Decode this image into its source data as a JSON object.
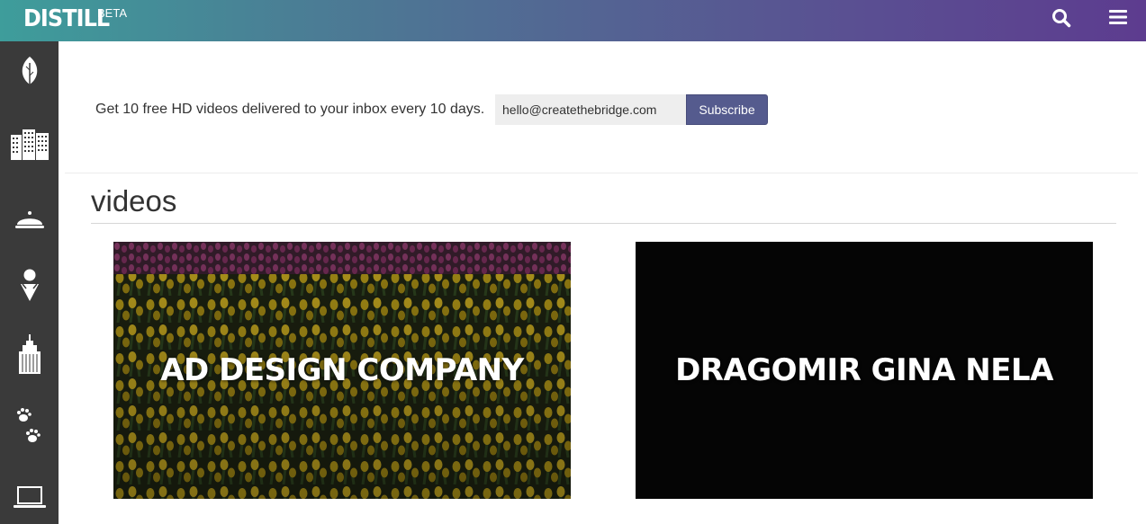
{
  "header": {
    "brand": "DISTILL",
    "beta": "BETA"
  },
  "sidebar": {
    "items": [
      {
        "icon": "leaf-icon"
      },
      {
        "icon": "buildings-icon"
      },
      {
        "icon": "food-cloche-icon"
      },
      {
        "icon": "person-pin-icon"
      },
      {
        "icon": "skyscraper-icon"
      },
      {
        "icon": "paw-prints-icon"
      },
      {
        "icon": "laptop-icon"
      }
    ]
  },
  "subscribe": {
    "promo_text": "Get 10 free HD videos delivered to your inbox every 10 days.",
    "email_value": "hello@createthebridge.com",
    "button_label": "Subscribe"
  },
  "section": {
    "title": "videos"
  },
  "videos": [
    {
      "title": "AD DESIGN COMPANY"
    },
    {
      "title": "DRAGOMIR GINA NELA"
    }
  ],
  "colors": {
    "gradient_start": "#3e9d9b",
    "gradient_end": "#5d3c8f",
    "sidebar_bg": "#3a3a3a",
    "subscribe_button": "#555b8e"
  }
}
